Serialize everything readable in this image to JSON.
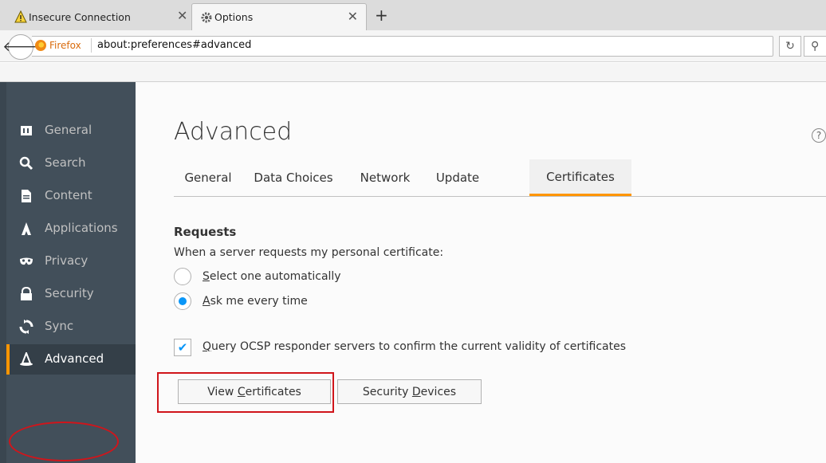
{
  "tabs": {
    "inactive_title": "Insecure Connection",
    "active_title": "Options"
  },
  "navbar": {
    "identity": "Firefox",
    "url": "about:preferences#advanced"
  },
  "sidebar": {
    "items": [
      {
        "label": "General",
        "icon": "general-icon"
      },
      {
        "label": "Search",
        "icon": "search-icon"
      },
      {
        "label": "Content",
        "icon": "content-icon"
      },
      {
        "label": "Applications",
        "icon": "applications-icon"
      },
      {
        "label": "Privacy",
        "icon": "privacy-mask-icon"
      },
      {
        "label": "Security",
        "icon": "lock-icon"
      },
      {
        "label": "Sync",
        "icon": "sync-icon"
      },
      {
        "label": "Advanced",
        "icon": "advanced-wizard-icon"
      }
    ],
    "selected": "Advanced"
  },
  "main": {
    "title": "Advanced",
    "tabs": [
      "General",
      "Data Choices",
      "Network",
      "Update",
      "Certificates"
    ],
    "active_tab": "Certificates",
    "requests": {
      "heading": "Requests",
      "description": "When a server requests my personal certificate:",
      "option_auto_prefix": "S",
      "option_auto_rest": "elect one automatically",
      "option_ask_prefix": "A",
      "option_ask_rest": "sk me every time",
      "selected_option": "Ask me every time"
    },
    "ocsp": {
      "prefix": "Q",
      "rest": "uery OCSP responder servers to confirm the current validity of certificates",
      "checked": true
    },
    "buttons": {
      "view_pre": "View ",
      "view_key": "C",
      "view_post": "ertificates",
      "devices_pre": "Security ",
      "devices_key": "D",
      "devices_post": "evices"
    }
  },
  "colors": {
    "accent": "#ff9500",
    "highlight_annotation": "#d0151b",
    "radio_blue": "#0996f8",
    "sidebar_bg": "#424f5a"
  }
}
